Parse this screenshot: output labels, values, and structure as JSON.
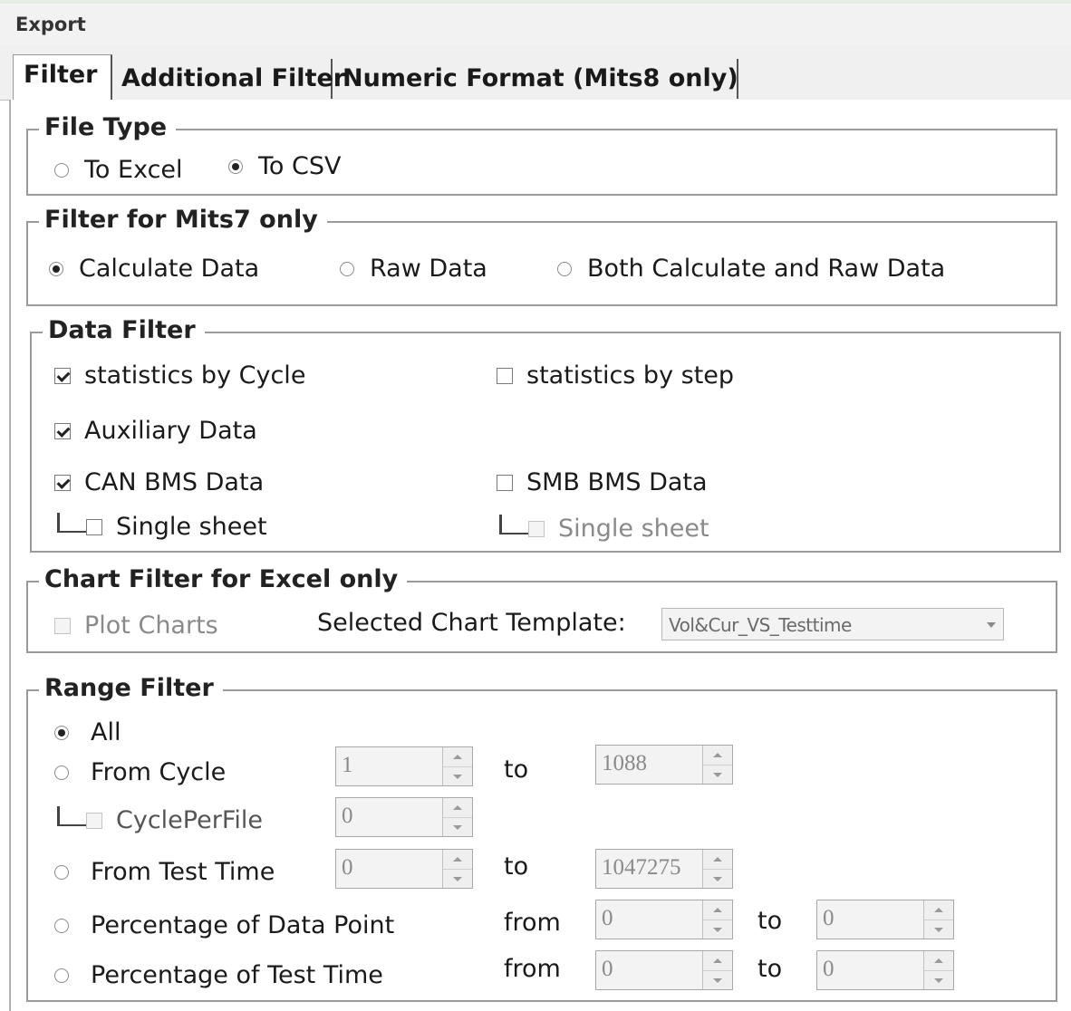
{
  "window": {
    "title": "Export"
  },
  "tabs": {
    "filter": "Filter",
    "additional": "Additional Filter",
    "numeric": "Numeric Format (Mits8 only)"
  },
  "file_type": {
    "title": "File Type",
    "to_excel": "To Excel",
    "to_csv": "To CSV",
    "selected": "To CSV"
  },
  "mits7": {
    "title": "Filter for Mits7 only",
    "calc": "Calculate Data",
    "raw": "Raw Data",
    "both": "Both Calculate and Raw Data",
    "selected": "Calculate Data"
  },
  "data_filter": {
    "title": "Data Filter",
    "stat_cycle": "statistics by Cycle",
    "stat_step": "statistics by step",
    "aux": "Auxiliary Data",
    "can_bms": "CAN BMS Data",
    "smb_bms": "SMB BMS Data",
    "single_sheet": "Single sheet",
    "single_sheet_2": "Single sheet"
  },
  "chart_filter": {
    "title": "Chart Filter for Excel only",
    "plot": "Plot Charts",
    "template_label": "Selected Chart Template:",
    "template_value": "Vol&Cur_VS_Testtime"
  },
  "range_filter": {
    "title": "Range Filter",
    "all": "All",
    "from_cycle": "From Cycle",
    "cycle_per_file": "CyclePerFile",
    "from_test_time": "From Test Time",
    "pct_data_point": "Percentage of Data Point",
    "pct_test_time": "Percentage of Test Time",
    "to": "to",
    "from": "from",
    "cycle_from": "1",
    "cycle_to": "1088",
    "cycle_per_file_val": "0",
    "time_from": "0",
    "time_to": "1047275",
    "pdp_from": "0",
    "pdp_to": "0",
    "ptt_from": "0",
    "ptt_to": "0",
    "selected": "All"
  }
}
